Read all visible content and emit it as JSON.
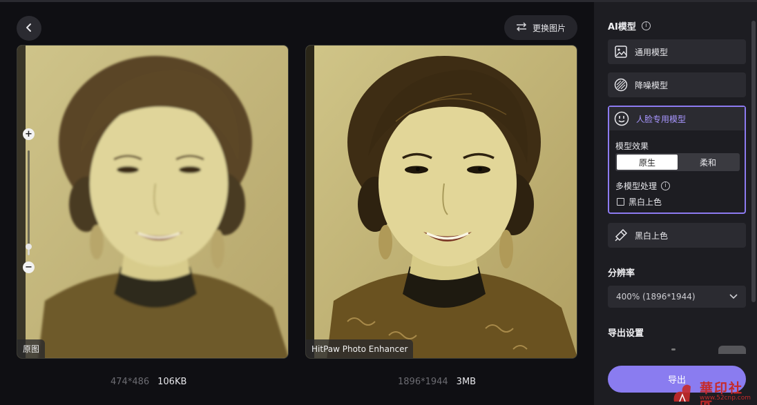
{
  "toolbar": {
    "change_image_label": "更换图片"
  },
  "preview": {
    "original_tag": "原图",
    "enhanced_tag": "HitPaw Photo Enhancer",
    "original_dims": "474*486",
    "original_size": "106KB",
    "enhanced_dims": "1896*1944",
    "enhanced_size": "3MB",
    "zoom_level": 0.08
  },
  "panel": {
    "ai_model_title": "AI模型",
    "models": [
      {
        "label": "通用模型",
        "icon": "image-icon"
      },
      {
        "label": "降噪模型",
        "icon": "denoise-icon"
      },
      {
        "label": "人脸专用模型",
        "icon": "face-icon"
      },
      {
        "label": "黑白上色",
        "icon": "colorize-icon"
      }
    ],
    "face_options": {
      "effect_label": "模型效果",
      "effect_options": [
        "原生",
        "柔和"
      ],
      "effect_selected": "原生",
      "multi_label": "多模型处理",
      "colorize_checkbox_label": "黑白上色"
    },
    "resolution_title": "分辨率",
    "resolution_value": "400% (1896*1944)",
    "export_settings_title": "导出设置",
    "export_label": "导出"
  },
  "watermark": {
    "text": "華印社區",
    "url": "www.52cnp.com"
  },
  "colors": {
    "accent": "#8a7cf0",
    "accent_text": "#a896ff",
    "panel_bg": "#1d1d22",
    "page_bg": "#0f0f13"
  }
}
